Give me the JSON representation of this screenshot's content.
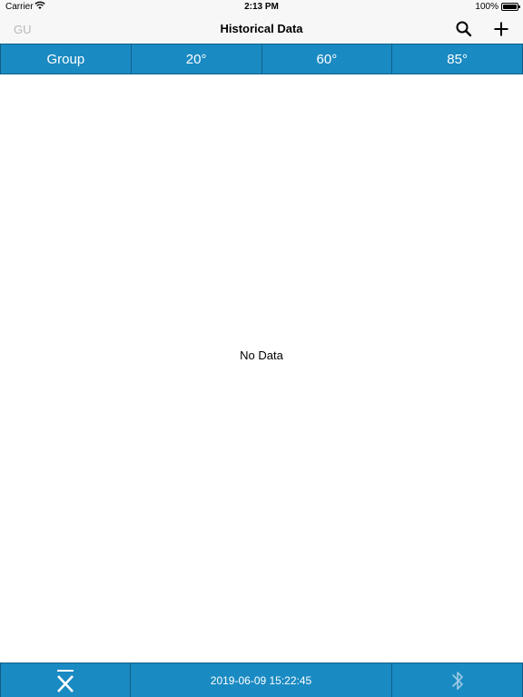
{
  "status_bar": {
    "carrier": "Carrier",
    "time": "2:13 PM",
    "battery": "100%",
    "icons": [
      "wifi-icon",
      "battery-icon"
    ]
  },
  "nav": {
    "left_button": "GU",
    "title": "Historical Data",
    "icons": [
      "search-icon",
      "add-icon"
    ]
  },
  "table_header": {
    "columns": [
      "Group",
      "20°",
      "60°",
      "85°"
    ]
  },
  "empty_state": "No Data",
  "tab_bar": {
    "mean_icon": "x-bar-icon",
    "datetime": "2019-06-09 15:22:45",
    "bluetooth_icon": "bluetooth-icon"
  },
  "colors": {
    "accent": "#1a8ac2",
    "border": "#0f5f88",
    "nav_background": "#f7f7f7",
    "disabled_text": "#b8b8b8"
  }
}
